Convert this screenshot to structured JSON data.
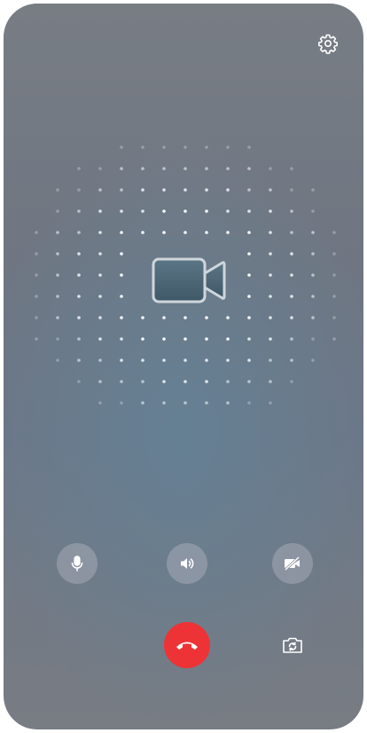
{
  "screen": "video-call-outgoing",
  "colors": {
    "hangup": "#ee3336",
    "control_bg": "#a5aab6",
    "icon": "#ffffff",
    "camera_fill": "#4e6878"
  },
  "icons": {
    "top_right": "gear-icon",
    "center": "video-camera-icon",
    "controls": [
      "microphone-icon",
      "speaker-icon",
      "camera-off-icon"
    ],
    "hangup": "phone-hangup-icon",
    "switch": "switch-camera-icon"
  }
}
